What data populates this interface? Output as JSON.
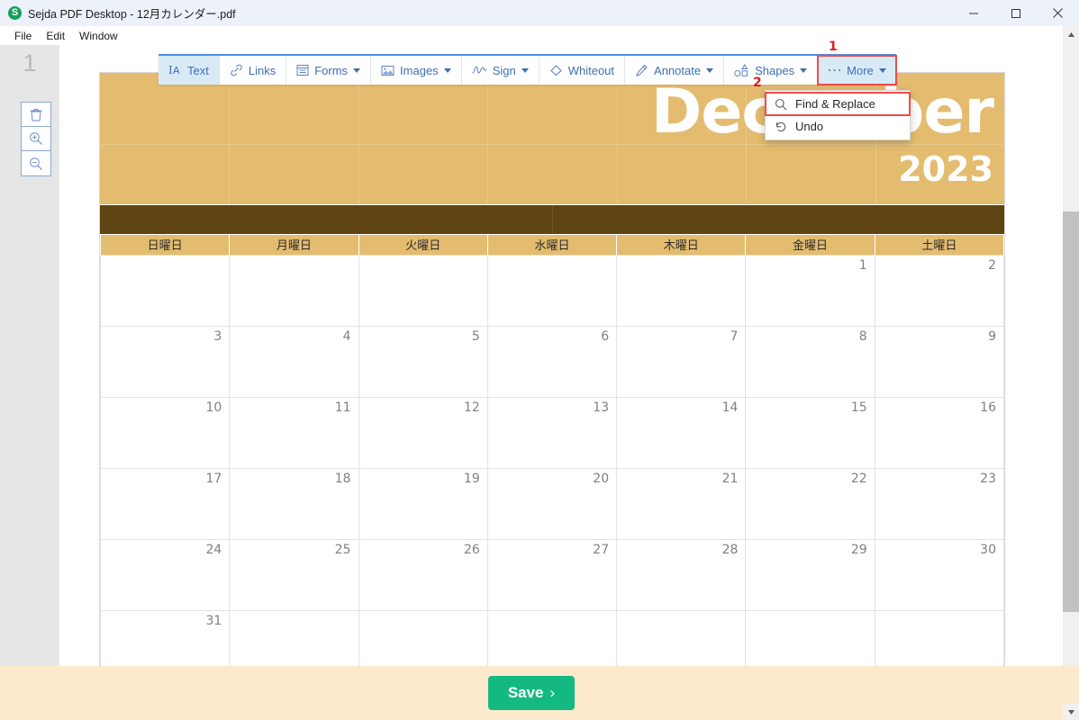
{
  "window": {
    "app_title": "Sejda PDF Desktop - 12月カレンダー.pdf",
    "logo_letter": "S",
    "minimize_label": "Minimize",
    "maximize_label": "Maximize",
    "close_label": "Close"
  },
  "menubar": {
    "items": [
      {
        "label": "File"
      },
      {
        "label": "Edit"
      },
      {
        "label": "Window"
      }
    ]
  },
  "left_panel": {
    "page_number": "1",
    "tools": [
      {
        "name": "delete-page-button",
        "icon": "trash-icon"
      },
      {
        "name": "zoom-in-button",
        "icon": "zoom-in-icon"
      },
      {
        "name": "zoom-out-button",
        "icon": "zoom-out-icon"
      }
    ]
  },
  "toolbar": {
    "buttons": [
      {
        "label": "Text",
        "icon": "text-cursor-icon",
        "caret": false,
        "active": true,
        "highlight": false
      },
      {
        "label": "Links",
        "icon": "link-icon",
        "caret": false,
        "active": false,
        "highlight": false
      },
      {
        "label": "Forms",
        "icon": "form-icon",
        "caret": true,
        "active": false,
        "highlight": false
      },
      {
        "label": "Images",
        "icon": "image-icon",
        "caret": true,
        "active": false,
        "highlight": false
      },
      {
        "label": "Sign",
        "icon": "signature-icon",
        "caret": true,
        "active": false,
        "highlight": false
      },
      {
        "label": "Whiteout",
        "icon": "eraser-icon",
        "caret": false,
        "active": false,
        "highlight": false
      },
      {
        "label": "Annotate",
        "icon": "highlighter-icon",
        "caret": true,
        "active": false,
        "highlight": false
      },
      {
        "label": "Shapes",
        "icon": "shapes-icon",
        "caret": true,
        "active": false,
        "highlight": false
      },
      {
        "label": "More",
        "icon": "ellipsis-icon",
        "caret": true,
        "active": false,
        "highlight": true
      }
    ]
  },
  "dropdown": {
    "items": [
      {
        "label": "Find & Replace",
        "icon": "search-icon",
        "selected": true
      },
      {
        "label": "Undo",
        "icon": "undo-icon",
        "selected": false
      }
    ]
  },
  "annotations": [
    {
      "number": "1"
    },
    {
      "number": "2"
    }
  ],
  "bottom_bar": {
    "save_label": "Save",
    "save_chevron": "›"
  },
  "colors": {
    "accent_blue": "#3e6fb0",
    "save_green": "#14b981",
    "annotation_red": "#e01b1b",
    "calendar_tan": "#e4bc70",
    "calendar_brown": "#5f4414",
    "bottom_cream": "#fdeacd",
    "titlebar_blue": "#edf2fa"
  },
  "calendar": {
    "month": "December",
    "year": "2023",
    "weekdays": [
      "日曜日",
      "月曜日",
      "火曜日",
      "水曜日",
      "木曜日",
      "金曜日",
      "土曜日"
    ],
    "weeks": [
      [
        "",
        "",
        "",
        "",
        "",
        "1",
        "2"
      ],
      [
        "3",
        "4",
        "5",
        "6",
        "7",
        "8",
        "9"
      ],
      [
        "10",
        "11",
        "12",
        "13",
        "14",
        "15",
        "16"
      ],
      [
        "17",
        "18",
        "19",
        "20",
        "21",
        "22",
        "23"
      ],
      [
        "24",
        "25",
        "26",
        "27",
        "28",
        "29",
        "30"
      ],
      [
        "31",
        "",
        "",
        "",
        "",
        "",
        ""
      ]
    ]
  }
}
